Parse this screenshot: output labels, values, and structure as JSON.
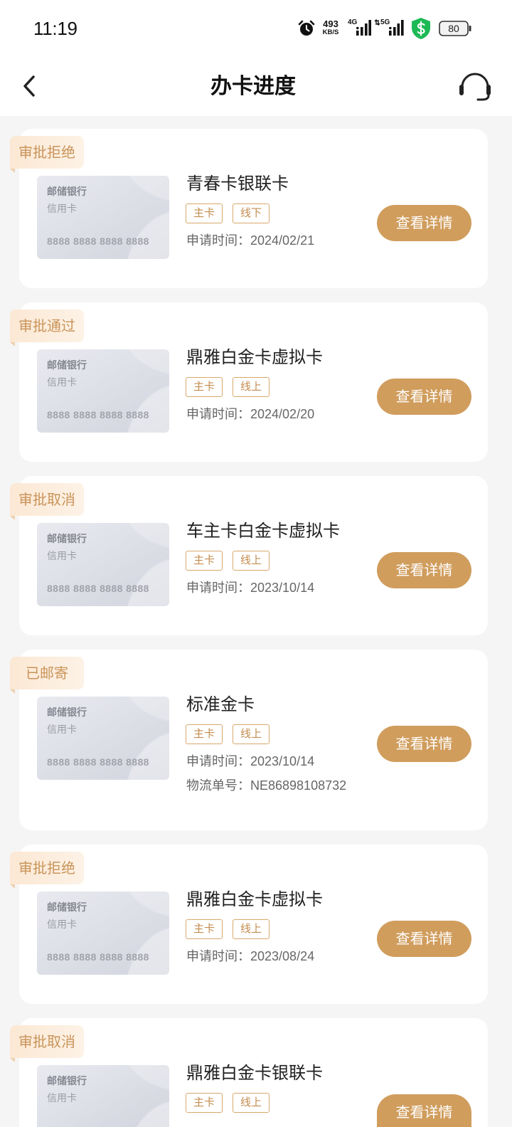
{
  "status_bar": {
    "time": "11:19",
    "alarm_icon": "alarm-clock-icon",
    "net_speed": "493",
    "net_speed_unit": "KB/S",
    "network_1": "4G",
    "network_2": "5G",
    "signal_icon": "cellular-signal-icon",
    "security_icon": "green-shield-dollar-icon",
    "battery": "80",
    "battery_icon": "battery-icon"
  },
  "header": {
    "back_icon": "back-arrow-icon",
    "title": "办卡进度",
    "service_icon": "customer-service-headset-icon"
  },
  "colors": {
    "accent": "#d09d5d",
    "status_badge_text": "#c9945a",
    "status_badge_bg": "#fcefe1",
    "tag_border": "#d8a86c",
    "page_bg": "#f5f5f5",
    "shield_green": "#1db954"
  },
  "labels": {
    "apply_time": "申请时间：",
    "tracking_number": "物流单号：",
    "details_button": "查看详情"
  },
  "card_face": {
    "bank": "邮储银行",
    "type": "信用卡",
    "number": "8888 8888 8888 8888"
  },
  "applications": [
    {
      "status": "审批拒绝",
      "name": "青春卡银联卡",
      "tags": [
        "主卡",
        "线下"
      ],
      "apply_date": "2024/02/21"
    },
    {
      "status": "审批通过",
      "name": "鼎雅白金卡虚拟卡",
      "tags": [
        "主卡",
        "线上"
      ],
      "apply_date": "2024/02/20"
    },
    {
      "status": "审批取消",
      "name": "车主卡白金卡虚拟卡",
      "tags": [
        "主卡",
        "线上"
      ],
      "apply_date": "2023/10/14"
    },
    {
      "status": "已邮寄",
      "name": "标准金卡",
      "tags": [
        "主卡",
        "线上"
      ],
      "apply_date": "2023/10/14",
      "tracking_number": "NE86898108732"
    },
    {
      "status": "审批拒绝",
      "name": "鼎雅白金卡虚拟卡",
      "tags": [
        "主卡",
        "线上"
      ],
      "apply_date": "2023/08/24"
    },
    {
      "status": "审批取消",
      "name": "鼎雅白金卡银联卡",
      "tags": [
        "主卡",
        "线上"
      ]
    }
  ]
}
